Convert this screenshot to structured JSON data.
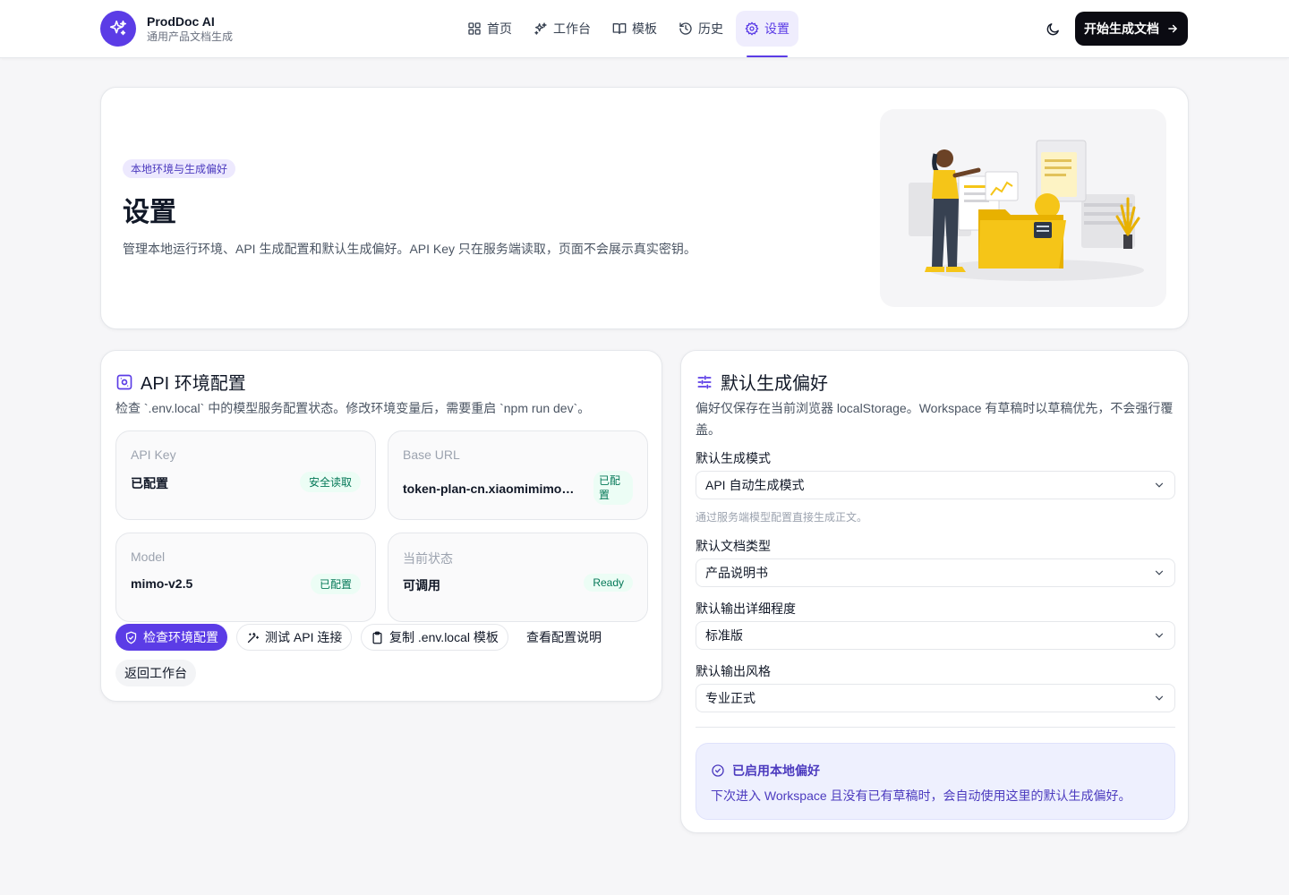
{
  "brand": {
    "name": "ProdDoc AI",
    "subtitle": "通用产品文档生成",
    "icon": "sparkles-icon"
  },
  "nav": [
    {
      "label": "首页",
      "icon": "grid-icon",
      "active": false
    },
    {
      "label": "工作台",
      "icon": "sparkles-icon",
      "active": false
    },
    {
      "label": "模板",
      "icon": "book-icon",
      "active": false
    },
    {
      "label": "历史",
      "icon": "history-icon",
      "active": false
    },
    {
      "label": "设置",
      "icon": "gear-icon",
      "active": true
    }
  ],
  "header": {
    "theme_icon": "moon-icon",
    "cta_label": "开始生成文档"
  },
  "hero": {
    "badge": "本地环境与生成偏好",
    "title": "设置",
    "description": "管理本地运行环境、API 生成配置和默认生成偏好。API Key 只在服务端读取，页面不会展示真实密钥。"
  },
  "api_card": {
    "title": "API 环境配置",
    "description": "检查 `.env.local` 中的模型服务配置状态。修改环境变量后，需要重启 `npm run dev`。",
    "stats": [
      {
        "label": "API Key",
        "value": "已配置",
        "badge": "安全读取"
      },
      {
        "label": "Base URL",
        "value": "token-plan-cn.xiaomimimo.com",
        "badge": "已配置"
      },
      {
        "label": "Model",
        "value": "mimo-v2.5",
        "badge": "已配置"
      },
      {
        "label": "当前状态",
        "value": "可调用",
        "badge": "Ready"
      }
    ],
    "buttons": {
      "check": "检查环境配置",
      "test": "测试 API 连接",
      "copy": "复制 .env.local 模板",
      "docs": "查看配置说明",
      "back": "返回工作台"
    }
  },
  "pref_card": {
    "title": "默认生成偏好",
    "description": "偏好仅保存在当前浏览器 localStorage。Workspace 有草稿时以草稿优先，不会强行覆盖。",
    "fields": [
      {
        "label": "默认生成模式",
        "value": "API 自动生成模式",
        "hint": "通过服务端模型配置直接生成正文。"
      },
      {
        "label": "默认文档类型",
        "value": "产品说明书"
      },
      {
        "label": "默认输出详细程度",
        "value": "标准版"
      },
      {
        "label": "默认输出风格",
        "value": "专业正式"
      }
    ],
    "notice": {
      "title": "已启用本地偏好",
      "text": "下次进入 Workspace 且没有已有草稿时，会自动使用这里的默认生成偏好。"
    }
  },
  "colors": {
    "accent": "#5b3ce6",
    "dark": "#0b0b12",
    "success": "#047857",
    "illustration_yellow": "#f5c518"
  }
}
